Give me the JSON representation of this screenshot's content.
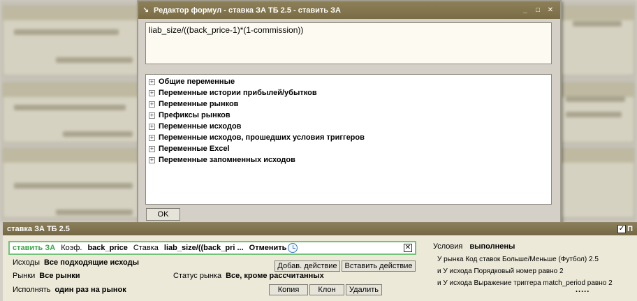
{
  "dialog": {
    "title": "Редактор формул - ставка ЗА ТБ 2.5 - ставить ЗА",
    "icon": "arrow-icon",
    "formula": "liab_size/((back_price-1)*(1-commission))",
    "tree_items": [
      "Общие переменные",
      "Переменные истории прибылей/убытков",
      "Переменные рынков",
      "Префиксы рынков",
      "Переменные исходов",
      "Переменные исходов, прошедших условия триггеров",
      "Переменные Excel",
      "Переменные запомненных исходов"
    ],
    "ok_label": "OK"
  },
  "panel": {
    "title": "ставка ЗА ТБ 2.5",
    "right_label": "П",
    "action": {
      "type": "ставить ЗА",
      "coef_label": "Коэф.",
      "coef_value": "back_price",
      "stake_label": "Ставка",
      "stake_value": "liab_size/((back_pri ...",
      "cancel_label": "Отменить"
    },
    "outcomes_label": "Исходы",
    "outcomes_value": "Все подходящие исходы",
    "markets_label": "Рынки",
    "markets_value": "Все рынки",
    "status_label": "Статус рынка",
    "status_value": "Все, кроме рассчитанных",
    "execute_label": "Исполнять",
    "execute_value": "один раз на рынок",
    "buttons": {
      "add_action": "Добав. действие",
      "insert_action": "Вставить действие",
      "copy": "Копия",
      "clone": "Клон",
      "delete": "Удалить"
    },
    "conditions": {
      "label": "Условия",
      "value": "выполнены",
      "items": [
        "У рынка Код ставок Больше/Меньше (Футбол) 2.5",
        "и У исхода Порядковый номер равно 2",
        "и У исхода Выражение триггера match_period равно 2"
      ],
      "more": "....."
    }
  },
  "colors": {
    "title_bar": "#7a6c44",
    "action_border": "#74c27a",
    "action_type": "#3da749",
    "formula_bg": "#fdfbf1"
  }
}
